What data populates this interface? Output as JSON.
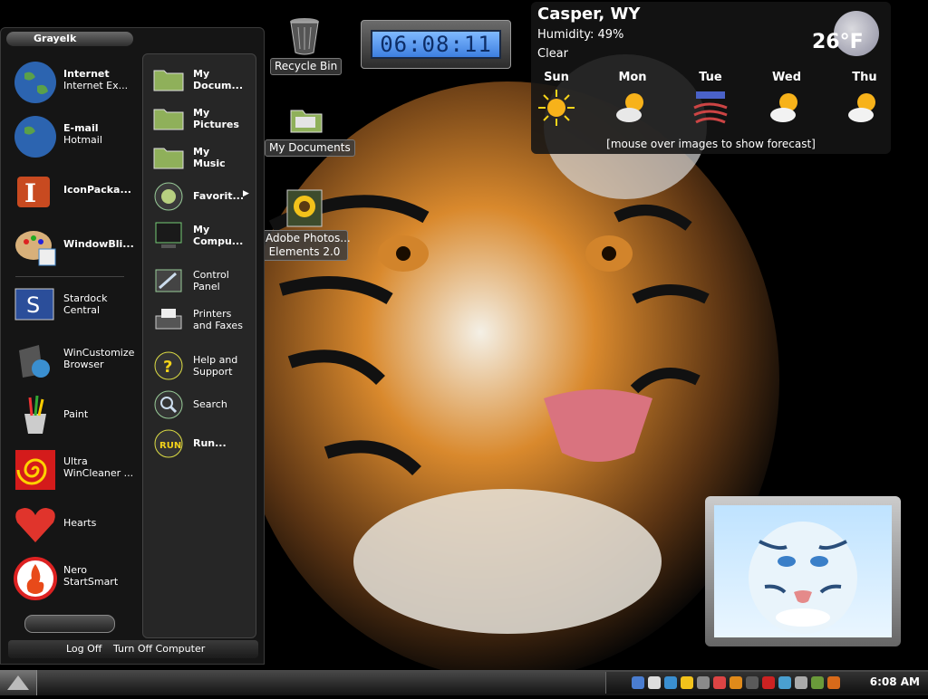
{
  "clock": {
    "time": "06:08:11"
  },
  "weather": {
    "location": "Casper, WY",
    "humidity": "Humidity: 49%",
    "condition": "Clear",
    "temperature": "26°F",
    "days": [
      {
        "name": "Sun",
        "icon": "sunny-icon"
      },
      {
        "name": "Mon",
        "icon": "partly-cloudy-icon"
      },
      {
        "name": "Tue",
        "icon": "windy-icon"
      },
      {
        "name": "Wed",
        "icon": "partly-cloudy-icon"
      },
      {
        "name": "Thu",
        "icon": "partly-cloudy-icon"
      }
    ],
    "hint": "[mouse over images to show forecast]"
  },
  "desktop_icons": {
    "recycle_bin": "Recycle Bin",
    "my_documents": "My Documents",
    "photoshop_line1": "Adobe Photos...",
    "photoshop_line2": "Elements 2.0"
  },
  "start_menu": {
    "user": "Grayelk",
    "pinned": [
      {
        "title": "Internet",
        "sub": "Internet Ex..."
      },
      {
        "title": "E-mail",
        "sub": "Hotmail"
      },
      {
        "title": "IconPacka...",
        "sub": ""
      },
      {
        "title": "WindowBli...",
        "sub": ""
      }
    ],
    "recent": [
      {
        "line1": "Stardock",
        "line2": "Central"
      },
      {
        "line1": "WinCustomize",
        "line2": "Browser"
      },
      {
        "line1": "Paint",
        "line2": ""
      },
      {
        "line1": "Ultra",
        "line2": "WinCleaner ..."
      },
      {
        "line1": "Hearts",
        "line2": ""
      },
      {
        "line1": "Nero",
        "line2": "StartSmart"
      }
    ],
    "places": [
      {
        "line1": "My",
        "line2": "Docum..."
      },
      {
        "line1": "My",
        "line2": "Pictures"
      },
      {
        "line1": "My",
        "line2": "Music"
      },
      {
        "line1": "Favorit...",
        "line2": ""
      },
      {
        "line1": "My",
        "line2": "Compu..."
      },
      {
        "line1": "Control",
        "line2": "Panel"
      },
      {
        "line1": "Printers",
        "line2": "and Faxes"
      },
      {
        "line1": "Help and",
        "line2": "Support"
      },
      {
        "line1": "Search",
        "line2": ""
      },
      {
        "line1": "Run...",
        "line2": ""
      }
    ],
    "log_off": "Log Off",
    "turn_off": "Turn Off Computer"
  },
  "taskbar": {
    "time": "6:08 AM"
  },
  "colors": {
    "clock_face": "#5a9cf2",
    "accent": "#2f6fe0"
  }
}
